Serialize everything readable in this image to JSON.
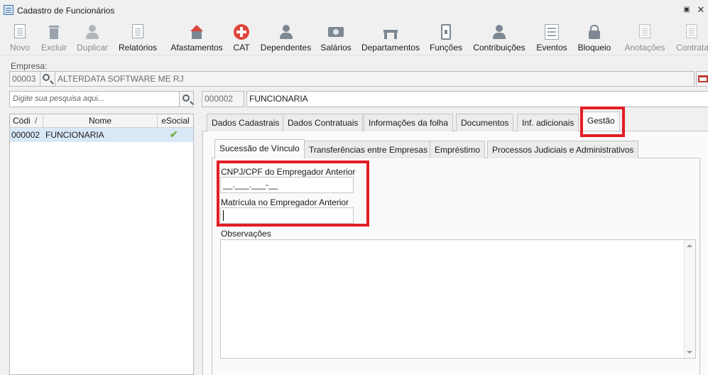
{
  "window": {
    "title": "Cadastro de Funcionários",
    "restore_icon": "restore-icon",
    "close_icon": "close-icon"
  },
  "toolbar": {
    "items": [
      {
        "label": "Novo",
        "icon": "new-doc-icon",
        "enabled": false
      },
      {
        "label": "Excluir",
        "icon": "trash-icon",
        "enabled": false
      },
      {
        "label": "Duplicar",
        "icon": "duplicate-people-icon",
        "enabled": false
      },
      {
        "label": "Relatórios",
        "icon": "report-icon",
        "enabled": true
      },
      {
        "label": "Afastamentos",
        "icon": "house-arrow-icon",
        "enabled": true
      },
      {
        "label": "CAT",
        "icon": "medical-cross-icon",
        "enabled": true
      },
      {
        "label": "Dependentes",
        "icon": "people-icon",
        "enabled": true
      },
      {
        "label": "Salários",
        "icon": "money-icon",
        "enabled": true
      },
      {
        "label": "Departamentos",
        "icon": "desk-icon",
        "enabled": true
      },
      {
        "label": "Funções",
        "icon": "badge-icon",
        "enabled": true
      },
      {
        "label": "Contribuições",
        "icon": "people-icon",
        "enabled": true
      },
      {
        "label": "Eventos",
        "icon": "list-icon",
        "enabled": true
      },
      {
        "label": "Bloqueio",
        "icon": "lock-icon",
        "enabled": true
      },
      {
        "label": "Anotações",
        "icon": "note-pen-icon",
        "enabled": false
      },
      {
        "label": "Contrata",
        "icon": "contract-icon",
        "enabled": false
      }
    ]
  },
  "empresa": {
    "label": "Empresa:",
    "code": "00003",
    "name": "ALTERDATA SOFTWARE ME RJ"
  },
  "search": {
    "placeholder": "Digite sua pesquisa aqui..."
  },
  "employee_header": {
    "code": "000002",
    "name": "FUNCIONARIA"
  },
  "grid": {
    "columns": [
      "Códi",
      "Nome",
      "eSocial"
    ],
    "sort_marker": "/",
    "rows": [
      {
        "code": "000002",
        "name": "FUNCIONARIA",
        "esocial": "check-icon"
      }
    ]
  },
  "tabs": [
    "Dados Cadastrais",
    "Dados Contratuais",
    "Informações da folha",
    "Documentos",
    "Inf. adicionais",
    "Gestão"
  ],
  "active_tab": "Gestão",
  "subtabs": [
    "Sucessão de Vínculo",
    "Transferências entre Empresas",
    "Empréstimo",
    "Processos Judiciais e Administrativos"
  ],
  "active_subtab": "Sucessão de Vínculo",
  "form": {
    "cnpj_label": "CNPJ/CPF do Empregador Anterior",
    "cnpj_value": "__.___.___-__",
    "matricula_label": "Matrícula no Empregador Anterior",
    "matricula_value": "",
    "obs_label": "Observações",
    "obs_value": ""
  },
  "highlight_color": "#e21d24"
}
